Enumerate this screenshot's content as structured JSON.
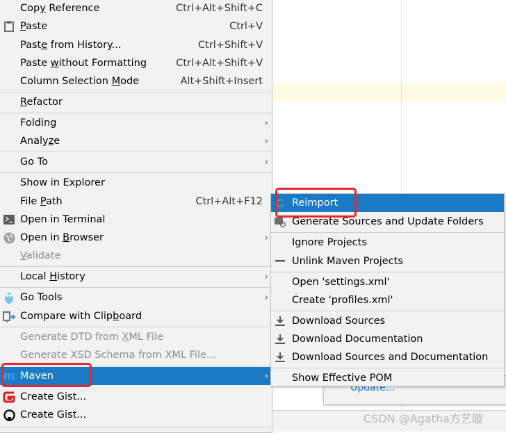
{
  "colors": {
    "highlight": "#1a7ac5",
    "menu_bg": "#f2f2f2",
    "annotation": "#e8262b"
  },
  "notification": {
    "link": "Update..."
  },
  "watermark": "CSDN @Agatha方艺璇",
  "main_menu": {
    "items": [
      {
        "label": "Copy Reference",
        "mnemonic": "y",
        "shortcut": "Ctrl+Alt+Shift+C"
      },
      {
        "label": "Paste",
        "mnemonic": "P",
        "shortcut": "Ctrl+V",
        "icon": "clipboard-icon"
      },
      {
        "label": "Paste from History...",
        "mnemonic": "e",
        "shortcut": "Ctrl+Shift+V"
      },
      {
        "label": "Paste without Formatting",
        "mnemonic": "w",
        "shortcut": "Ctrl+Alt+Shift+V"
      },
      {
        "label": "Column Selection Mode",
        "mnemonic": "M",
        "shortcut": "Alt+Shift+Insert"
      },
      {
        "label": "Refactor",
        "mnemonic": "R"
      },
      {
        "label": "Folding",
        "submenu": true
      },
      {
        "label": "Analyze",
        "mnemonic": "z",
        "submenu": true
      },
      {
        "label": "Go To",
        "submenu": true
      },
      {
        "label": "Show in Explorer"
      },
      {
        "label": "File Path",
        "mnemonic": "P",
        "shortcut": "Ctrl+Alt+F12"
      },
      {
        "label": "Open in Terminal",
        "icon": "terminal-icon"
      },
      {
        "label": "Open in Browser",
        "mnemonic": "B",
        "submenu": true,
        "icon": "globe-icon"
      },
      {
        "label": "Validate",
        "mnemonic": "V",
        "disabled": true
      },
      {
        "label": "Local History",
        "mnemonic": "H",
        "submenu": true
      },
      {
        "label": "Go Tools",
        "submenu": true,
        "icon": "gopher-icon"
      },
      {
        "label": "Compare with Clipboard",
        "mnemonic": "b",
        "icon": "compare-icon"
      },
      {
        "label": "Generate DTD from XML File",
        "mnemonic": "X",
        "disabled": true
      },
      {
        "label": "Generate XSD Schema from XML File...",
        "disabled": true
      },
      {
        "label": "Maven",
        "submenu": true,
        "selected": true,
        "icon": "maven-icon"
      },
      {
        "label": "Create Gist...",
        "icon": "gitee-icon"
      },
      {
        "label": "Create Gist...",
        "icon": "github-icon"
      }
    ]
  },
  "maven_submenu": {
    "items": [
      {
        "label": "Reimport",
        "selected": true,
        "icon": "refresh-icon"
      },
      {
        "label": "Generate Sources and Update Folders",
        "icon": "generate-folder-icon"
      },
      {
        "label": "Ignore Projects"
      },
      {
        "label": "Unlink Maven Projects",
        "icon": "minus-icon"
      },
      {
        "label": "Open 'settings.xml'"
      },
      {
        "label": "Create 'profiles.xml'"
      },
      {
        "label": "Download Sources",
        "icon": "download-icon"
      },
      {
        "label": "Download Documentation",
        "icon": "download-icon"
      },
      {
        "label": "Download Sources and Documentation",
        "icon": "download-icon"
      },
      {
        "label": "Show Effective POM"
      }
    ]
  }
}
